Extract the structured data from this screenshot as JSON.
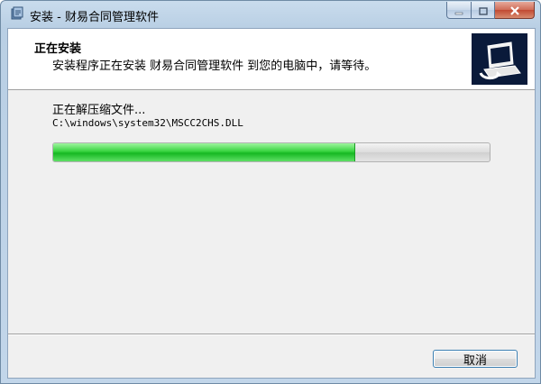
{
  "window": {
    "title": "安装 - 财易合同管理软件",
    "icon": "installer-icon"
  },
  "caption_buttons": {
    "minimize": "minimize-icon",
    "maximize": "maximize-icon",
    "close": "close-icon"
  },
  "header": {
    "title": "正在安装",
    "subtitle": "安装程序正在安装 财易合同管理软件 到您的电脑中，请等待。",
    "image": "installer-computer-icon"
  },
  "status": {
    "text": "正在解压缩文件...",
    "file": "C:\\windows\\system32\\MSCC2CHS.DLL"
  },
  "progress": {
    "fraction": 0.69,
    "fill_color": "#16b822"
  },
  "buttons": {
    "cancel": "取消"
  }
}
